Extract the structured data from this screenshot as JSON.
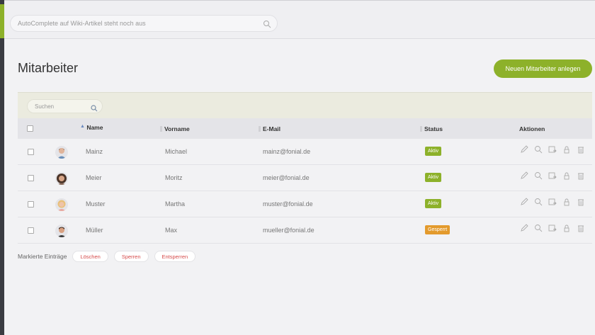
{
  "colors": {
    "accent": "#8db12a",
    "active": "#8db12a",
    "blocked": "#e39a2c",
    "danger": "#d64b4b"
  },
  "search": {
    "placeholder": "AutoComplete auf Wiki-Artikel steht noch aus"
  },
  "page": {
    "title": "Mitarbeiter",
    "new_button": "Neuen Mitarbeiter anlegen"
  },
  "filter": {
    "placeholder": "Suchen"
  },
  "table": {
    "headers": {
      "name": "Name",
      "vorname": "Vorname",
      "email": "E-Mail",
      "status": "Status",
      "actions": "Aktionen"
    },
    "rows": [
      {
        "name": "Mainz",
        "vorname": "Michael",
        "email": "mainz@fonial.de",
        "status": "Aktiv"
      },
      {
        "name": "Meier",
        "vorname": "Moritz",
        "email": "meier@fonial.de",
        "status": "Aktiv"
      },
      {
        "name": "Muster",
        "vorname": "Martha",
        "email": "muster@fonial.de",
        "status": "Aktiv"
      },
      {
        "name": "Müller",
        "vorname": "Max",
        "email": "mueller@fonial.de",
        "status": "Gesperrt"
      }
    ],
    "action_icons": [
      "edit-icon",
      "search-icon",
      "forward-icon",
      "lock-icon",
      "trash-icon"
    ]
  },
  "footer": {
    "label": "Markierte Einträge",
    "delete": "Löschen",
    "block": "Sperren",
    "unblock": "Entsperren"
  }
}
